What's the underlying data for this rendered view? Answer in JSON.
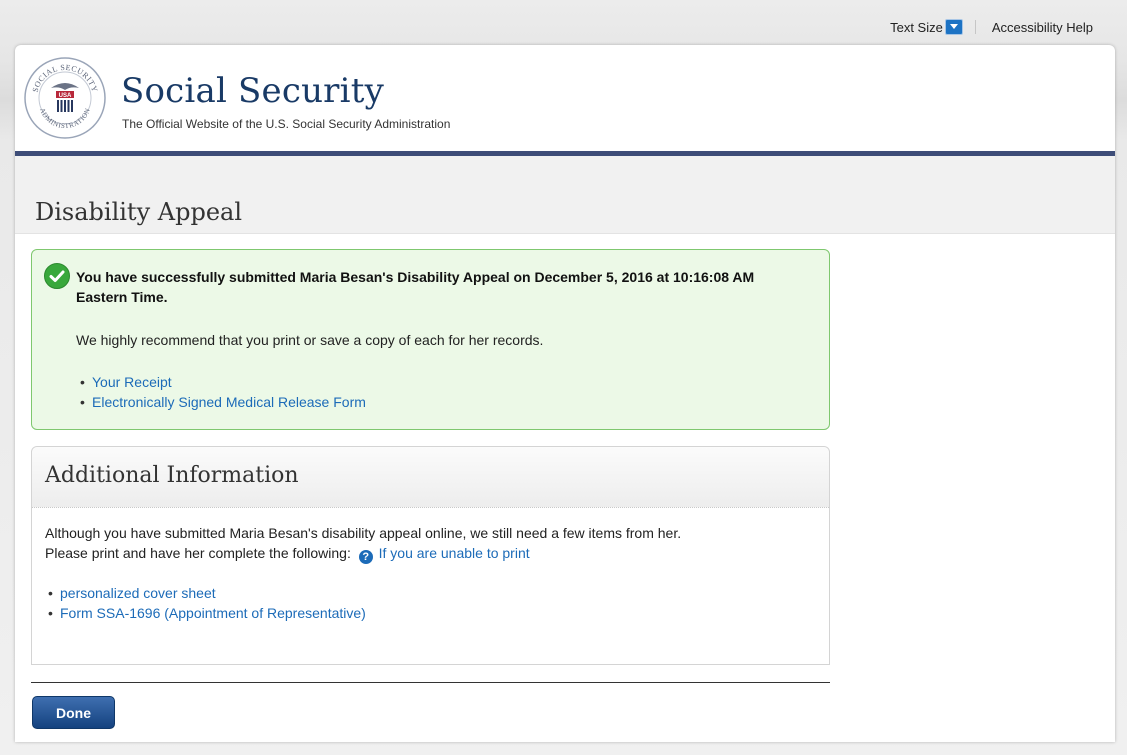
{
  "utility": {
    "text_size_label": "Text Size",
    "accessibility_help_label": "Accessibility Help"
  },
  "header": {
    "title": "Social Security",
    "subtitle": "The Official Website of the U.S. Social Security Administration",
    "seal_text": "SOCIAL SECURITY ADMINISTRATION USA"
  },
  "page": {
    "title": "Disability Appeal"
  },
  "success": {
    "heading": "You have successfully submitted Maria Besan's Disability Appeal on December 5, 2016 at 10:16:08 AM Eastern Time.",
    "text": "We highly recommend that you print or save a copy of each for her records.",
    "links": [
      {
        "label": "Your Receipt"
      },
      {
        "label": "Electronically Signed Medical Release Form"
      }
    ]
  },
  "additional": {
    "title": "Additional Information",
    "line1": "Although you have submitted Maria Besan's disability appeal online, we still need a few items from her.",
    "line2": "Please print and have her complete the following:",
    "help_link": "If you are unable to print",
    "links": [
      {
        "label": "personalized cover sheet"
      },
      {
        "label": "Form SSA-1696 (Appointment of Representative)"
      }
    ]
  },
  "actions": {
    "done_label": "Done"
  },
  "colors": {
    "brand_navy": "#193a66",
    "header_rule": "#3e4d78",
    "link_blue": "#1c6bb8",
    "success_border": "#7fc86f",
    "success_bg": "#ecf9e7",
    "button_blue": "#14427f"
  }
}
